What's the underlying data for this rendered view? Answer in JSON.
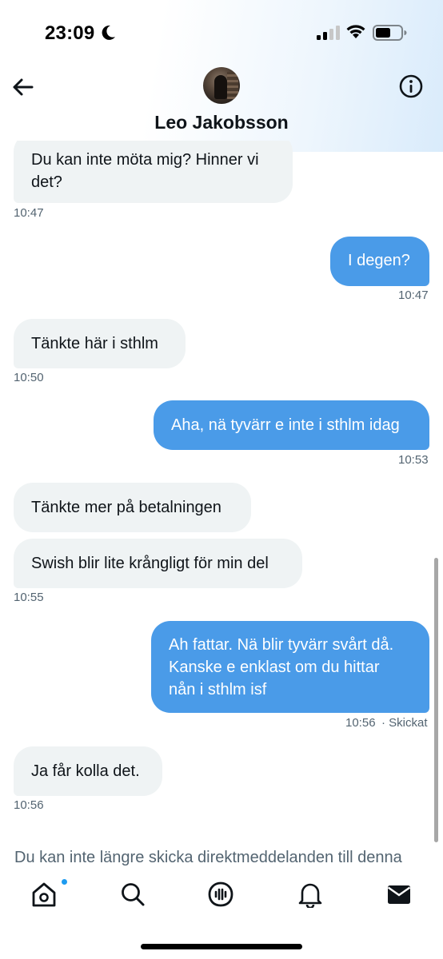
{
  "status_bar": {
    "time": "23:09"
  },
  "header": {
    "contact_name": "Leo Jakobsson"
  },
  "messages": [
    {
      "direction": "in",
      "text": "Du kan inte möta mig? Hinner vi det?",
      "line1": "Du kan inte möta mig? Hinner vi",
      "line2": "det?",
      "time": "10:47"
    },
    {
      "direction": "out",
      "text": "I degen?",
      "time": "10:47"
    },
    {
      "direction": "in",
      "text": "Tänkte här i sthlm",
      "time": "10:50"
    },
    {
      "direction": "out",
      "text": "Aha, nä tyvärr e inte i sthlm idag",
      "time": "10:53"
    },
    {
      "direction": "in",
      "text": "Tänkte mer på betalningen"
    },
    {
      "direction": "in",
      "text": "Swish blir lite krångligt för min del",
      "time": "10:55"
    },
    {
      "direction": "out",
      "text": "Ah fattar. Nä blir tyvärr svårt då. Kanske e enklast om du hittar nån i sthlm isf",
      "line1": "Ah fattar. Nä blir tyvärr svårt då.",
      "line2": "Kanske e enklast om du hittar",
      "line3": "nån i sthlm isf",
      "time": "10:56",
      "status": "· Skickat"
    },
    {
      "direction": "in",
      "text": "Ja får kolla det.",
      "time": "10:56"
    }
  ],
  "notice": "Du kan inte längre skicka direktmeddelanden till denna",
  "bottom_nav": {
    "items": [
      "home-icon",
      "search-icon",
      "spaces-icon",
      "notifications-icon",
      "messages-icon"
    ],
    "home_has_notification_dot": true
  },
  "colors": {
    "outgoing_bubble": "#4a9be8",
    "incoming_bubble": "#eff3f4",
    "accent": "#1d9bf0",
    "timestamp": "#536471"
  }
}
